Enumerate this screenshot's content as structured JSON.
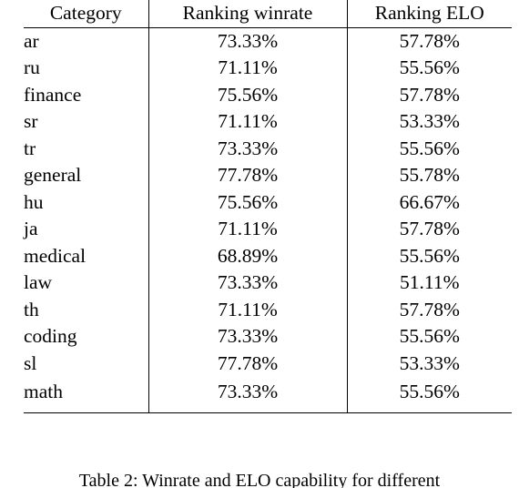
{
  "table": {
    "columns": [
      {
        "key": "category",
        "label": "Category",
        "align": "left"
      },
      {
        "key": "winrate",
        "label": "Ranking winrate",
        "align": "center"
      },
      {
        "key": "elo",
        "label": "Ranking ELO",
        "align": "center"
      }
    ],
    "rows": [
      {
        "category": "ar",
        "winrate": "73.33%",
        "elo": "57.78%"
      },
      {
        "category": "ru",
        "winrate": "71.11%",
        "elo": "55.56%"
      },
      {
        "category": "finance",
        "winrate": "75.56%",
        "elo": "57.78%"
      },
      {
        "category": "sr",
        "winrate": "71.11%",
        "elo": "53.33%"
      },
      {
        "category": "tr",
        "winrate": "73.33%",
        "elo": "55.56%"
      },
      {
        "category": "general",
        "winrate": "77.78%",
        "elo": "55.78%"
      },
      {
        "category": "hu",
        "winrate": "75.56%",
        "elo": "66.67%"
      },
      {
        "category": "ja",
        "winrate": "71.11%",
        "elo": "57.78%"
      },
      {
        "category": "medical",
        "winrate": "68.89%",
        "elo": "55.56%"
      },
      {
        "category": "law",
        "winrate": "73.33%",
        "elo": "51.11%"
      },
      {
        "category": "th",
        "winrate": "71.11%",
        "elo": "57.78%"
      },
      {
        "category": "coding",
        "winrate": "73.33%",
        "elo": "55.56%"
      },
      {
        "category": "sl",
        "winrate": "77.78%",
        "elo": "53.33%"
      },
      {
        "category": "math",
        "winrate": "73.33%",
        "elo": "55.56%"
      }
    ]
  },
  "caption": {
    "text": "Table 2: Winrate and ELO capability for different"
  }
}
